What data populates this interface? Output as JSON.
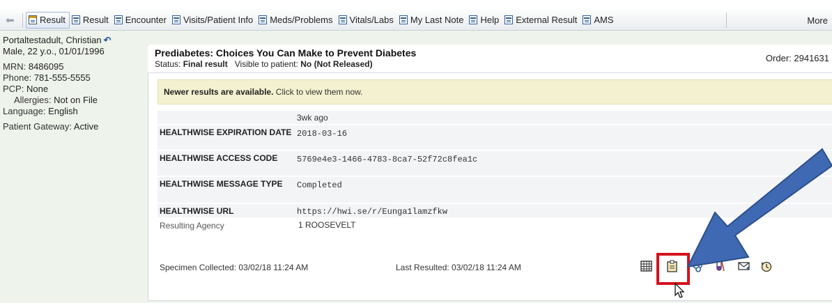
{
  "toolbar": {
    "tabs": [
      {
        "label": "Result",
        "active": true
      },
      {
        "label": "Result"
      },
      {
        "label": "Encounter"
      },
      {
        "label": "Visits/Patient Info"
      },
      {
        "label": "Meds/Problems"
      },
      {
        "label": "Vitals/Labs"
      },
      {
        "label": "My Last Note"
      },
      {
        "label": "Help"
      },
      {
        "label": "External Result"
      },
      {
        "label": "AMS"
      }
    ],
    "more_label": "More"
  },
  "patient": {
    "name": "Portaltestadult, Christian",
    "demographics": "Male, 22 y.o., 01/01/1996",
    "mrn_label": "MRN:",
    "mrn": "8486095",
    "phone_label": "Phone:",
    "phone": "781-555-5555",
    "pcp_label": "PCP:",
    "pcp": "None",
    "allergies_label": "Allergies:",
    "allergies": "Not on File",
    "language_label": "Language:",
    "language": "English",
    "gateway_label": "Patient Gateway:",
    "gateway": "Active"
  },
  "result": {
    "title": "Prediabetes: Choices You Can Make to Prevent Diabetes",
    "status_label": "Status:",
    "status": "Final result",
    "visible_label": "Visible to patient:",
    "visible": "No (Not Released)",
    "order": "Order: 2941631",
    "banner_bold": "Newer results are available.",
    "banner_text": "Click to view them now.",
    "column_header": "3wk ago",
    "rows": [
      {
        "name": "HEALTHWISE EXPIRATION DATE",
        "value": "2018-03-16"
      },
      {
        "name": "HEALTHWISE ACCESS CODE",
        "value": "5769e4e3-1466-4783-8ca7-52f72c8fea1c"
      },
      {
        "name": "HEALTHWISE MESSAGE TYPE",
        "value": "Completed"
      },
      {
        "name": "HEALTHWISE URL",
        "value": "https://hwi.se/r/Eunga1lamzfkw"
      },
      {
        "name": "Resulting Agency",
        "value": "1 ROOSEVELT"
      }
    ],
    "specimen_collected": "Specimen Collected: 03/02/18 11:24 AM",
    "last_resulted": "Last Resulted: 03/02/18 11:24 AM"
  },
  "icons": [
    "table-icon",
    "clipboard-icon",
    "stethoscope-icon",
    "beaker-icon",
    "envelope-icon",
    "history-icon"
  ],
  "colors": {
    "highlight": "#d4121e",
    "arrow": "#3f6ab3",
    "banner": "#f4f1d0"
  }
}
